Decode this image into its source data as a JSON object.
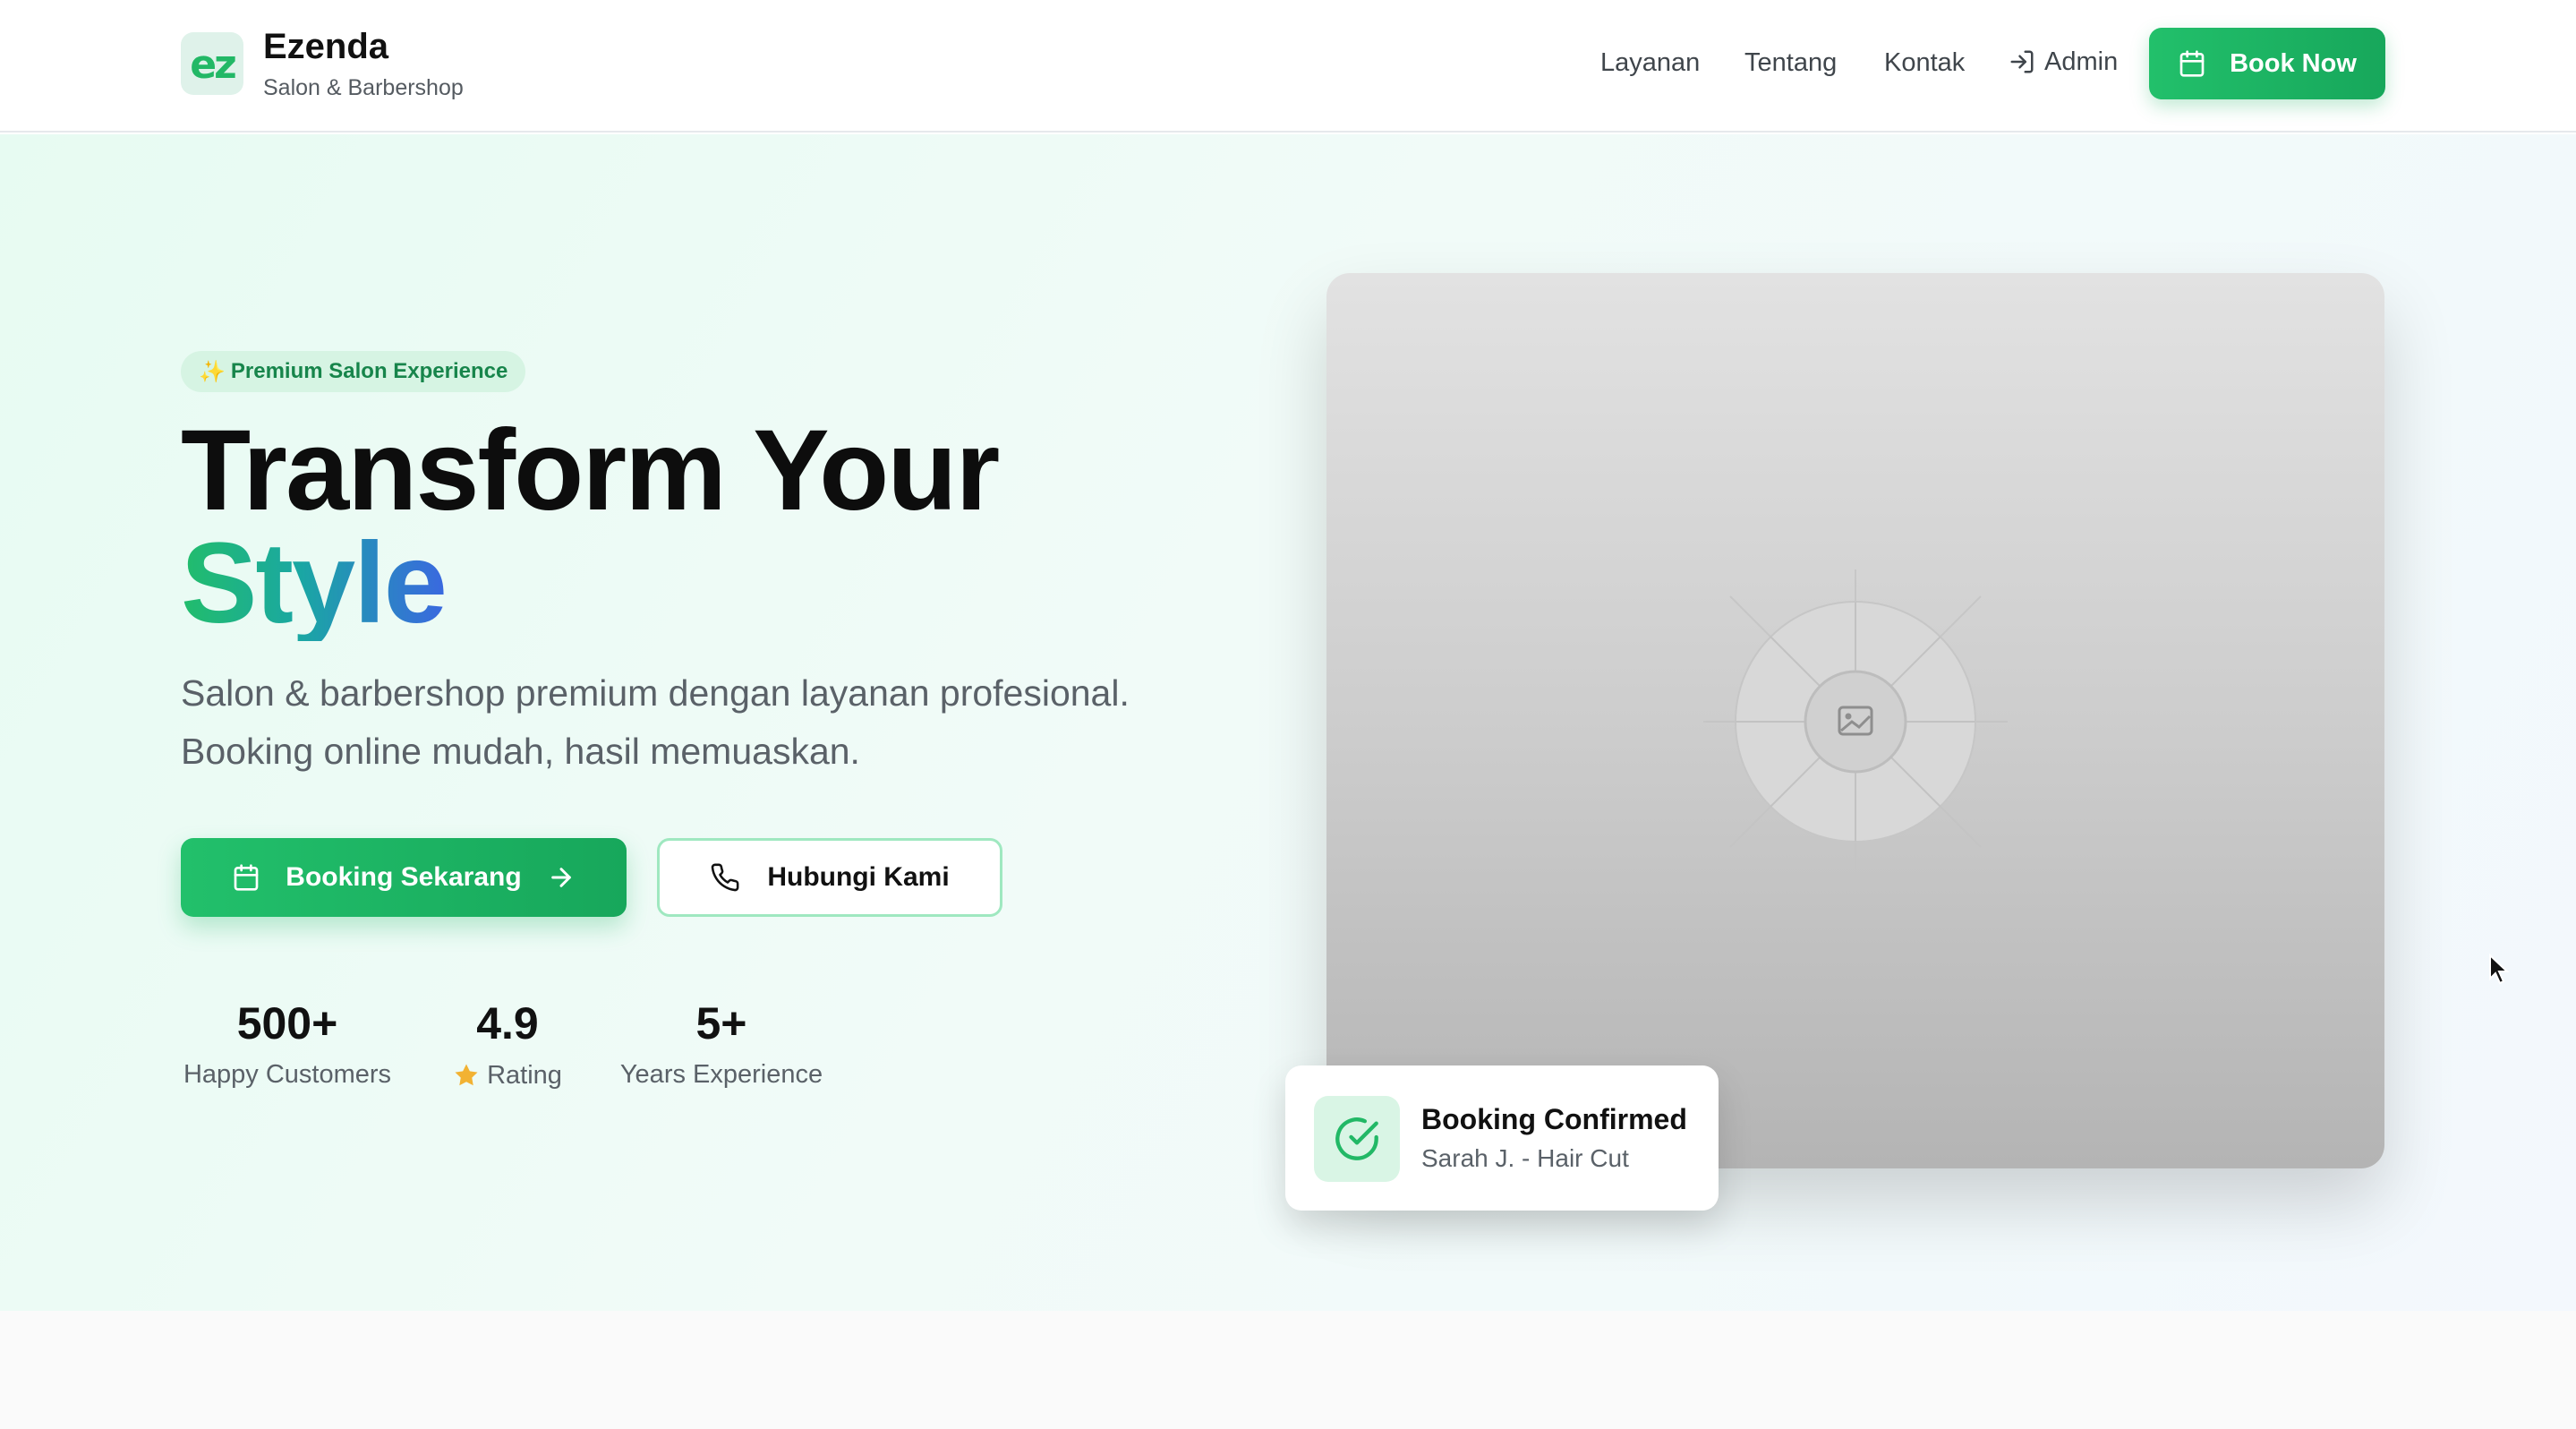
{
  "brand": {
    "logo_text": "ez",
    "name": "Ezenda",
    "tagline": "Salon & Barbershop"
  },
  "nav": {
    "links": [
      "Layanan",
      "Tentang",
      "Kontak"
    ],
    "admin_label": "Admin",
    "book_now_label": "Book Now"
  },
  "hero": {
    "badge_icon": "✨",
    "badge_text": "Premium Salon Experience",
    "headline_line1": "Transform Your",
    "headline_line2": "Style",
    "description_line1": "Salon & barbershop premium dengan layanan profesional.",
    "description_line2": "Booking online mudah, hasil memuaskan.",
    "primary_button": "Booking Sekarang",
    "secondary_button": "Hubungi Kami"
  },
  "stats": [
    {
      "value": "500+",
      "label": "Happy Customers"
    },
    {
      "value": "4.9",
      "label": "Rating",
      "icon": "star-icon"
    },
    {
      "value": "5+",
      "label": "Years Experience"
    }
  ],
  "confirmation": {
    "title": "Booking Confirmed",
    "subtitle": "Sarah J. - Hair Cut"
  },
  "colors": {
    "accent_green": "#22c06b",
    "accent_blue": "#3a68e0",
    "hero_bg": "#e7fbf2",
    "star": "#f2b233"
  }
}
